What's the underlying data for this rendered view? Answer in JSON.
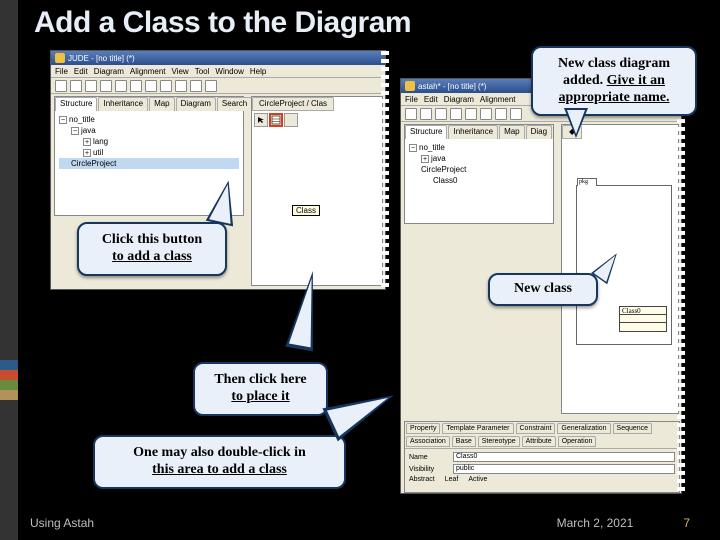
{
  "slide": {
    "title": "Add a Class to the Diagram"
  },
  "window_left": {
    "title": "JUDE - [no title] (*)",
    "menu": [
      "File",
      "Edit",
      "Diagram",
      "Alignment",
      "View",
      "Tool",
      "Window",
      "Help"
    ],
    "tabs": [
      "Structure",
      "Inheritance",
      "Map",
      "Diagram",
      "Search"
    ],
    "tree": {
      "root": "no_title",
      "children": [
        "java",
        "lang",
        "util",
        "CircleProject"
      ]
    },
    "canvas_tab": "CircleProject / Clas",
    "class_tooltip": "Class"
  },
  "window_right": {
    "title": "astah* - [no title] (*)",
    "menu": [
      "File",
      "Edit",
      "Diagram",
      "Alignment"
    ],
    "tabs": [
      "Structure",
      "Inheritance",
      "Map",
      "Diag"
    ],
    "tree": {
      "root": "no_title",
      "children": [
        "java",
        "CircleProject",
        "Class0"
      ]
    },
    "pkg_label": "pkg",
    "uml_class_name": "Class0",
    "prop_tabs_top": [
      "Property",
      "Template Parameter",
      "Constraint"
    ],
    "prop_tabs_mid": [
      "Generalization",
      "Sequence",
      "Association"
    ],
    "prop_tabs_bot": [
      "Base",
      "Stereotype",
      "Attribute",
      "Operation"
    ],
    "fields": {
      "name_label": "Name",
      "name_value": "Class0",
      "visibility_label": "Visibility",
      "visibility_value": "public",
      "abstract_label": "Abstract",
      "leaf_label": "Leaf",
      "active_label": "Active"
    }
  },
  "callouts": {
    "c1a": "Click this button",
    "c1b": "to add a class",
    "c2a": "Then click here",
    "c2b": "to place it",
    "c3a": "One may also double-click in",
    "c3b": "this area to add a class",
    "c4a": "New class diagram",
    "c4b": "added.  ",
    "c4c": "Give it an",
    "c4d": "appropriate name.",
    "c5": "New class"
  },
  "footer": {
    "left": "Using Astah",
    "date": "March 2, 2021",
    "page": "7"
  }
}
